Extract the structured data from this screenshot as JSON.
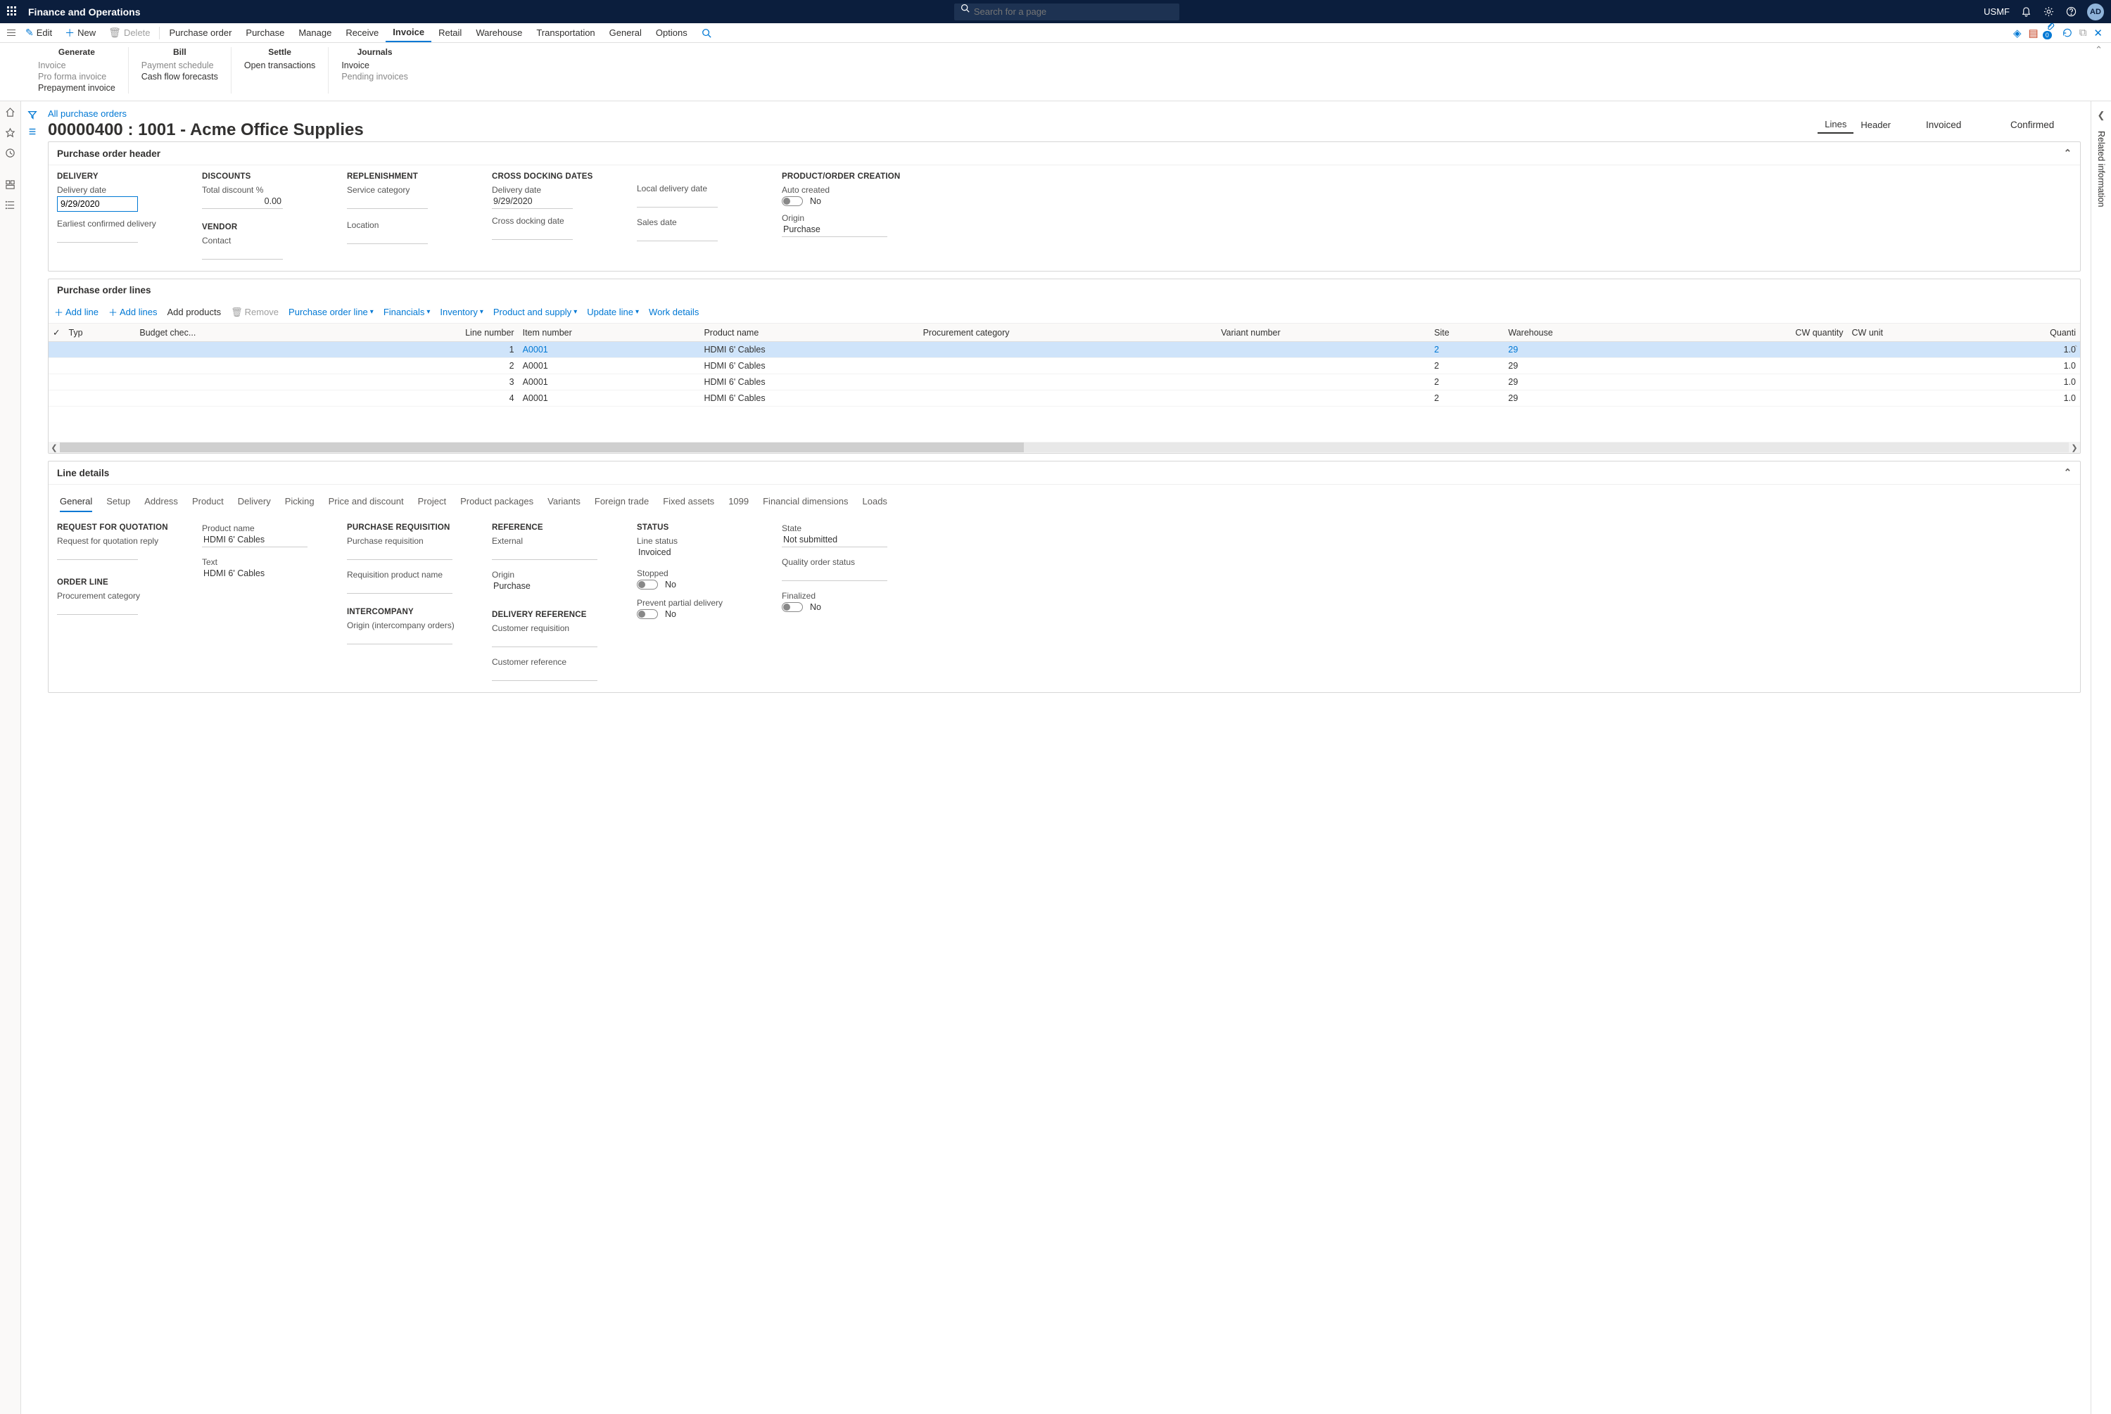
{
  "app_title": "Finance and Operations",
  "search_placeholder": "Search for a page",
  "company": "USMF",
  "avatar": "AD",
  "toolbar": {
    "edit": "Edit",
    "new": "New",
    "delete": "Delete",
    "tabs": [
      "Purchase order",
      "Purchase",
      "Manage",
      "Receive",
      "Invoice",
      "Retail",
      "Warehouse",
      "Transportation",
      "General",
      "Options"
    ],
    "active_tab": "Invoice"
  },
  "ribbon": [
    {
      "title": "Generate",
      "items": [
        {
          "label": "Invoice",
          "enabled": false
        },
        {
          "label": "Pro forma invoice",
          "enabled": false
        },
        {
          "label": "Prepayment invoice",
          "enabled": true
        }
      ]
    },
    {
      "title": "Bill",
      "items": [
        {
          "label": "Payment schedule",
          "enabled": false
        },
        {
          "label": "Cash flow forecasts",
          "enabled": true
        }
      ]
    },
    {
      "title": "Settle",
      "items": [
        {
          "label": "Open transactions",
          "enabled": true
        }
      ]
    },
    {
      "title": "Journals",
      "items": [
        {
          "label": "Invoice",
          "enabled": true
        },
        {
          "label": "Pending invoices",
          "enabled": false
        }
      ]
    }
  ],
  "breadcrumb": "All purchase orders",
  "page_title": "00000400 : 1001 - Acme Office Supplies",
  "view_tabs": {
    "lines": "Lines",
    "header": "Header"
  },
  "status_1": "Invoiced",
  "status_2": "Confirmed",
  "right_panel": "Related information",
  "po_header": {
    "title": "Purchase order header",
    "delivery": {
      "head": "DELIVERY",
      "date_label": "Delivery date",
      "date_value": "9/29/2020",
      "confirmed_label": "Earliest confirmed delivery"
    },
    "discounts": {
      "head": "DISCOUNTS",
      "total_label": "Total discount %",
      "total_value": "0.00"
    },
    "vendor": {
      "head": "VENDOR",
      "contact_label": "Contact"
    },
    "replenishment": {
      "head": "REPLENISHMENT",
      "service_label": "Service category",
      "location_label": "Location"
    },
    "cross_dock": {
      "head": "CROSS DOCKING DATES",
      "delivery_date_label": "Delivery date",
      "delivery_date_value": "9/29/2020",
      "cross_label": "Cross docking date"
    },
    "extra": {
      "local_label": "Local delivery date",
      "sales_label": "Sales date"
    },
    "product_order": {
      "head": "PRODUCT/ORDER CREATION",
      "auto_label": "Auto created",
      "auto_value": "No",
      "origin_label": "Origin",
      "origin_value": "Purchase"
    }
  },
  "po_lines": {
    "title": "Purchase order lines",
    "toolbar": {
      "add_line": "Add line",
      "add_lines": "Add lines",
      "add_products": "Add products",
      "remove": "Remove",
      "po_line": "Purchase order line",
      "financials": "Financials",
      "inventory": "Inventory",
      "product_supply": "Product and supply",
      "update_line": "Update line",
      "work_details": "Work details"
    },
    "columns": [
      "",
      "Typ",
      "Budget chec...",
      "Line number",
      "Item number",
      "Product name",
      "Procurement category",
      "Variant number",
      "Site",
      "Warehouse",
      "CW quantity",
      "CW unit",
      "Quanti"
    ],
    "rows": [
      {
        "line": 1,
        "item": "A0001",
        "product": "HDMI 6' Cables",
        "site": "2",
        "warehouse": "29",
        "qty": "1.0",
        "selected": true,
        "link": true
      },
      {
        "line": 2,
        "item": "A0001",
        "product": "HDMI 6' Cables",
        "site": "2",
        "warehouse": "29",
        "qty": "1.0"
      },
      {
        "line": 3,
        "item": "A0001",
        "product": "HDMI 6' Cables",
        "site": "2",
        "warehouse": "29",
        "qty": "1.0"
      },
      {
        "line": 4,
        "item": "A0001",
        "product": "HDMI 6' Cables",
        "site": "2",
        "warehouse": "29",
        "qty": "1.0"
      }
    ]
  },
  "line_details": {
    "title": "Line details",
    "tabs": [
      "General",
      "Setup",
      "Address",
      "Product",
      "Delivery",
      "Picking",
      "Price and discount",
      "Project",
      "Product packages",
      "Variants",
      "Foreign trade",
      "Fixed assets",
      "1099",
      "Financial dimensions",
      "Loads"
    ],
    "active_tab": "General",
    "rfq": {
      "head": "REQUEST FOR QUOTATION",
      "reply_label": "Request for quotation reply"
    },
    "order_line": {
      "head": "ORDER LINE",
      "proc_label": "Procurement category"
    },
    "product": {
      "name_label": "Product name",
      "name_value": "HDMI 6' Cables",
      "text_label": "Text",
      "text_value": "HDMI 6' Cables"
    },
    "pr": {
      "head": "PURCHASE REQUISITION",
      "pr_label": "Purchase requisition",
      "rpn_label": "Requisition product name"
    },
    "intercompany": {
      "head": "INTERCOMPANY",
      "origin_label": "Origin (intercompany orders)"
    },
    "reference": {
      "head": "REFERENCE",
      "external_label": "External",
      "origin_label": "Origin",
      "origin_value": "Purchase"
    },
    "del_ref": {
      "head": "DELIVERY REFERENCE",
      "cust_req_label": "Customer requisition",
      "cust_ref_label": "Customer reference"
    },
    "status": {
      "head": "STATUS",
      "line_status_label": "Line status",
      "line_status_value": "Invoiced",
      "stopped_label": "Stopped",
      "stopped_value": "No",
      "prevent_label": "Prevent partial delivery",
      "prevent_value": "No"
    },
    "state": {
      "state_label": "State",
      "state_value": "Not submitted",
      "qos_label": "Quality order status",
      "finalized_label": "Finalized",
      "finalized_value": "No"
    }
  }
}
